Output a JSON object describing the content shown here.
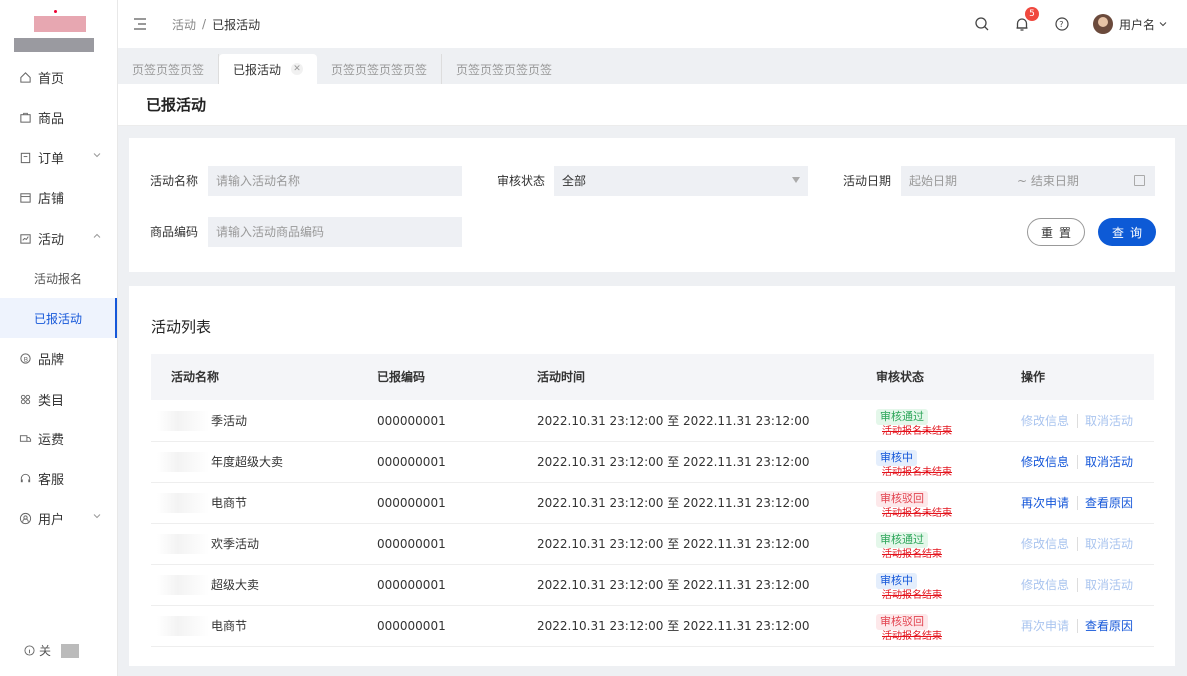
{
  "sidebar": {
    "items": [
      {
        "label": "首页",
        "icon": "home-icon"
      },
      {
        "label": "商品",
        "icon": "bag-icon"
      },
      {
        "label": "订单",
        "icon": "clipboard-icon"
      },
      {
        "label": "店铺",
        "icon": "shop-icon"
      },
      {
        "label": "活动",
        "icon": "activity-icon"
      },
      {
        "label": "品牌",
        "icon": "brand-icon"
      },
      {
        "label": "类目",
        "icon": "category-icon"
      },
      {
        "label": "运费",
        "icon": "shipping-icon"
      },
      {
        "label": "客服",
        "icon": "headset-icon"
      },
      {
        "label": "用户",
        "icon": "user-icon"
      }
    ],
    "sub_items": [
      "活动报名",
      "已报活动"
    ],
    "footer": "关"
  },
  "header": {
    "breadcrumb": [
      "活动",
      "已报活动"
    ],
    "notification_count": "5",
    "username": "用户名"
  },
  "tabs": [
    {
      "label": "页签页签页签"
    },
    {
      "label": "已报活动"
    },
    {
      "label": "页签页签页签页签"
    },
    {
      "label": "页签页签页签页签"
    }
  ],
  "page_title": "已报活动",
  "filter": {
    "name_label": "活动名称",
    "name_placeholder": "请输入活动名称",
    "status_label": "审核状态",
    "status_value": "全部",
    "date_label": "活动日期",
    "date_start": "起始日期",
    "date_end": "~ 结束日期",
    "code_label": "商品编码",
    "code_placeholder": "请输入活动商品编码",
    "reset": "重置",
    "query": "查询"
  },
  "list": {
    "title": "活动列表",
    "columns": [
      "活动名称",
      "已报编码",
      "活动时间",
      "审核状态",
      "操作"
    ],
    "rows": [
      {
        "name": "季活动",
        "code": "000000001",
        "time": "2022.10.31 23:12:00 至 2022.11.31 23:12:00",
        "status": "审核通过",
        "note": "活动报名未结束",
        "ops": [
          "修改信息",
          "取消活动"
        ]
      },
      {
        "name": "年度超级大卖",
        "code": "000000001",
        "time": "2022.10.31 23:12:00 至 2022.11.31 23:12:00",
        "status": "审核中",
        "note": "活动报名未结束",
        "ops": [
          "修改信息",
          "取消活动"
        ]
      },
      {
        "name": "电商节",
        "code": "000000001",
        "time": "2022.10.31 23:12:00 至 2022.11.31 23:12:00",
        "status": "审核驳回",
        "note": "活动报名未结束",
        "ops": [
          "再次申请",
          "查看原因"
        ]
      },
      {
        "name": "欢季活动",
        "code": "000000001",
        "time": "2022.10.31 23:12:00 至 2022.11.31 23:12:00",
        "status": "审核通过",
        "note": "活动报名结束",
        "ops": [
          "修改信息",
          "取消活动"
        ]
      },
      {
        "name": "超级大卖",
        "code": "000000001",
        "time": "2022.10.31 23:12:00 至 2022.11.31 23:12:00",
        "status": "审核中",
        "note": "活动报名结束",
        "ops": [
          "修改信息",
          "取消活动"
        ]
      },
      {
        "name": "电商节",
        "code": "000000001",
        "time": "2022.10.31 23:12:00 至 2022.11.31 23:12:00",
        "status": "审核驳回",
        "note": "活动报名结束",
        "ops": [
          "再次申请",
          "查看原因"
        ]
      }
    ]
  },
  "colors": {
    "primary": "#0d5ad6",
    "pass": "#2ea65a",
    "pending": "#1557d9",
    "reject": "#e2434f",
    "note": "#e3131c"
  }
}
